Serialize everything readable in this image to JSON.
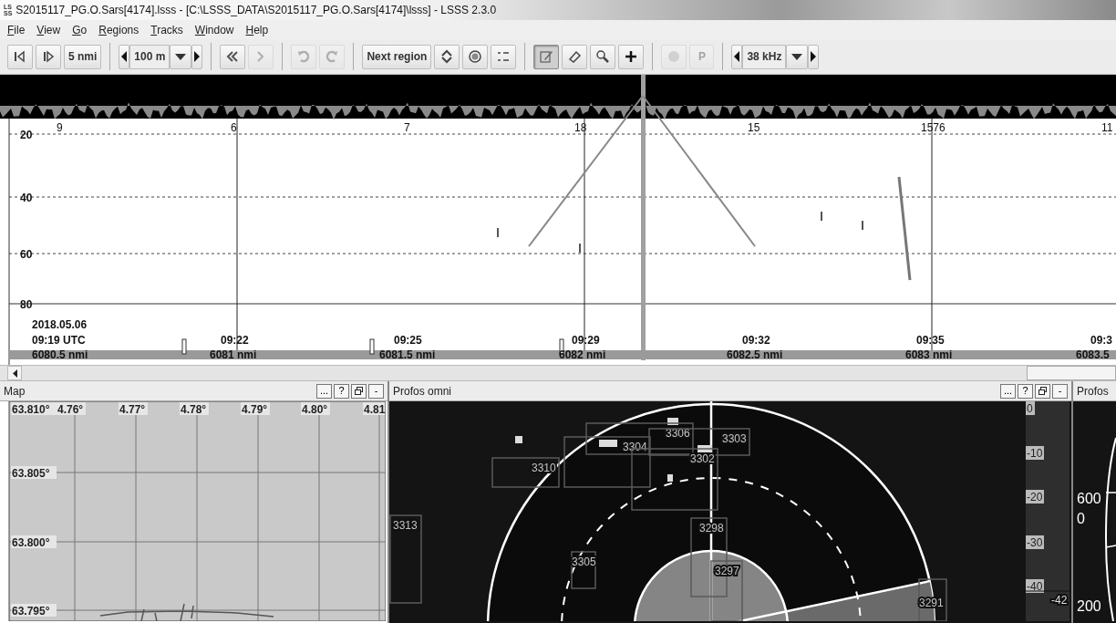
{
  "window": {
    "title": "S2015117_PG.O.Sars[4174].lsss - [C:\\LSSS_DATA\\S2015117_PG.O.Sars[4174]\\lsss] - LSSS 2.3.0",
    "logo_lines": [
      "LS",
      "SS"
    ]
  },
  "menu": [
    {
      "label": "File"
    },
    {
      "label": "View"
    },
    {
      "label": "Go"
    },
    {
      "label": "Regions"
    },
    {
      "label": "Tracks"
    },
    {
      "label": "Window"
    },
    {
      "label": "Help"
    }
  ],
  "toolbar": {
    "groups": [
      [
        {
          "kind": "stepback",
          "disabled": false
        },
        {
          "kind": "stepforward",
          "disabled": false
        },
        {
          "kind": "text",
          "label": "5 nmi",
          "disabled": false
        }
      ],
      [
        {
          "kind": "spinner",
          "value": "100 m",
          "disabled": false
        }
      ],
      [
        {
          "kind": "back",
          "disabled": false
        },
        {
          "kind": "forward",
          "disabled": true
        }
      ],
      [
        {
          "kind": "undo",
          "disabled": true
        },
        {
          "kind": "redo",
          "disabled": true
        }
      ],
      [
        {
          "kind": "text",
          "label": "Next region",
          "disabled": false
        },
        {
          "kind": "swap",
          "disabled": false
        },
        {
          "kind": "target",
          "disabled": false
        },
        {
          "kind": "list",
          "disabled": false
        }
      ],
      [
        {
          "kind": "pencil",
          "disabled": false,
          "selected": true
        },
        {
          "kind": "eraser",
          "disabled": false,
          "selected": false
        },
        {
          "kind": "zoom",
          "disabled": false,
          "selected": false
        },
        {
          "kind": "plus",
          "disabled": false,
          "selected": false
        }
      ],
      [
        {
          "kind": "record",
          "disabled": true
        },
        {
          "kind": "text",
          "label": "P",
          "disabled": true
        }
      ],
      [
        {
          "kind": "spinner",
          "value": "38 kHz",
          "disabled": false
        }
      ]
    ]
  },
  "echogram": {
    "region_counts": [
      "9",
      "6",
      "7",
      "18",
      "15",
      "1576",
      "11"
    ],
    "depth_labels": [
      "20",
      "40",
      "60",
      "80"
    ],
    "date": "2018.05.06",
    "times": [
      "09:19 UTC",
      "09:22",
      "09:25",
      "09:29",
      "09:32",
      "09:35",
      "09:3"
    ],
    "distances": [
      "6080.5 nmi",
      "6081 nmi",
      "6081.5 nmi",
      "6082 nmi",
      "6082.5 nmi",
      "6083 nmi",
      "6083.5"
    ]
  },
  "map": {
    "title": "Map",
    "header_buttons": [
      "...",
      "?",
      "-"
    ],
    "longitudes": [
      "4.76°",
      "4.77°",
      "4.78°",
      "4.79°",
      "4.80°",
      "4.81"
    ],
    "latitudes": [
      "63.810°",
      "63.805°",
      "63.800°",
      "63.795°"
    ]
  },
  "sonar": {
    "title": "Profos omni",
    "header_buttons": [
      "...",
      "?",
      "-"
    ],
    "targets": [
      "3310",
      "3304",
      "3306",
      "3303",
      "3302",
      "3313",
      "3298",
      "3305",
      "3297",
      "3291"
    ],
    "scale": [
      "0",
      "-10",
      "-20",
      "-30",
      "-40"
    ],
    "scale_marker": "-42"
  },
  "profos": {
    "title": "Profos",
    "labels": [
      "600",
      "0",
      "200"
    ]
  }
}
